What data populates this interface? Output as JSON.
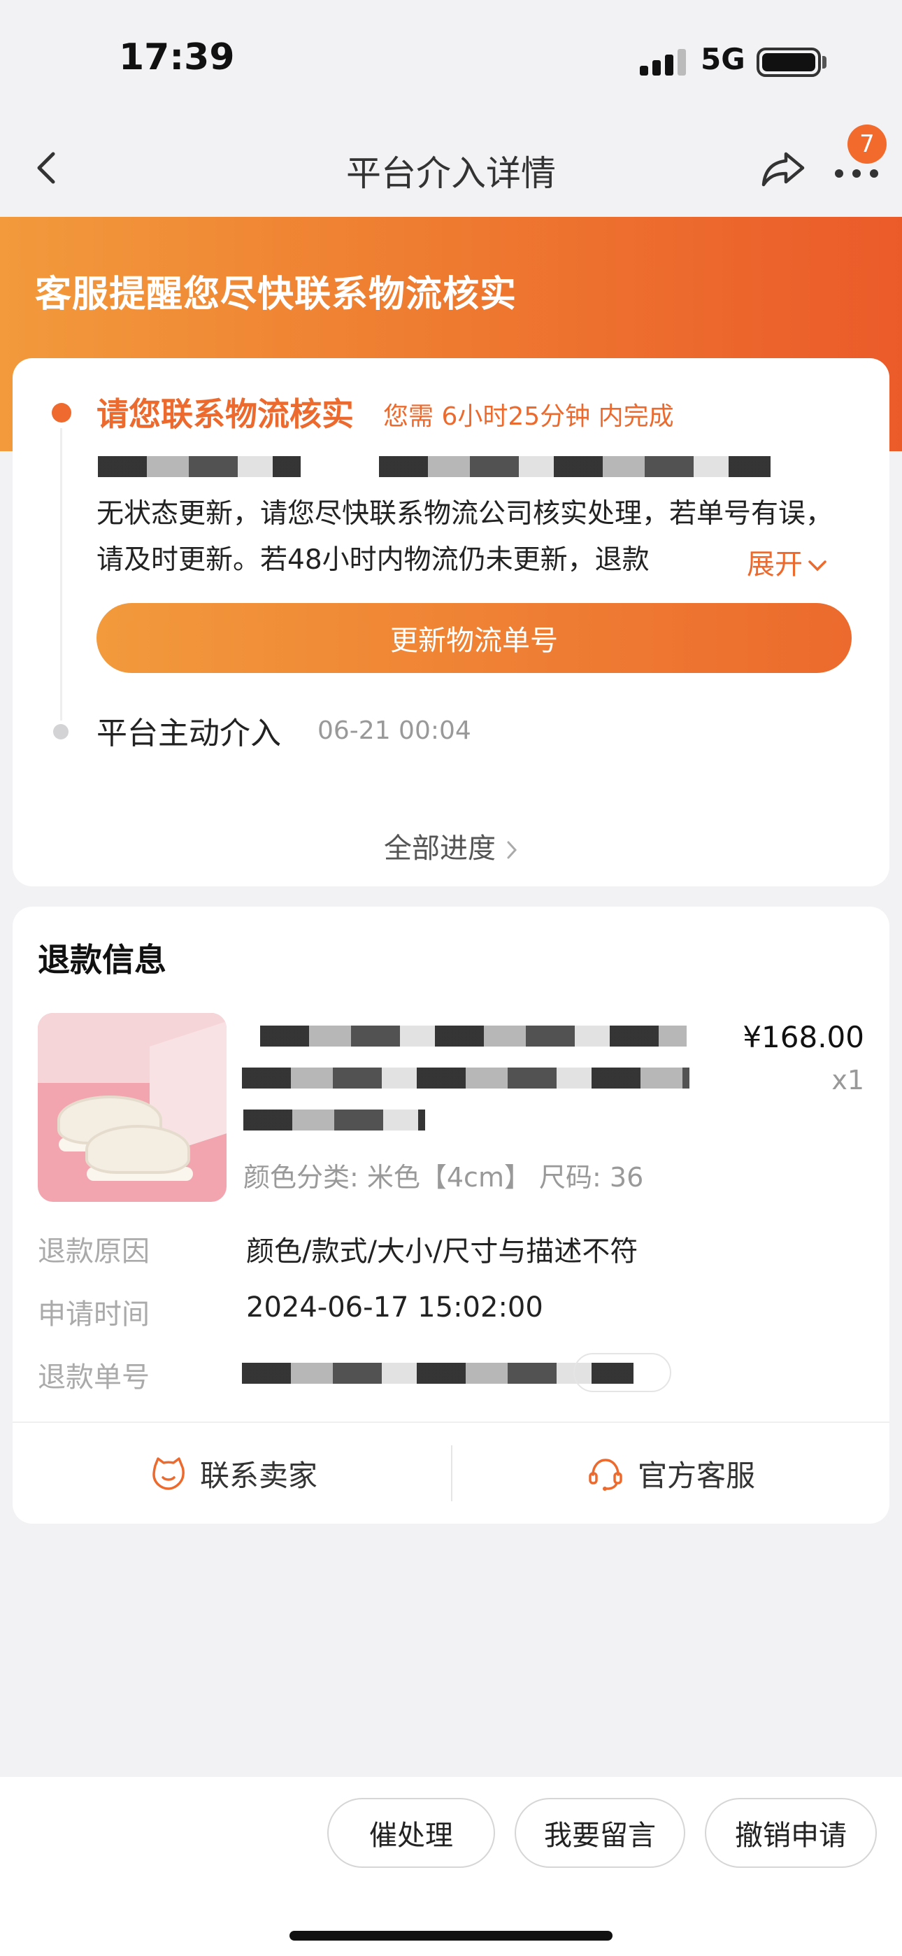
{
  "status_bar": {
    "time": "17:39",
    "network": "5G"
  },
  "nav": {
    "title": "平台介入详情",
    "badge_count": "7"
  },
  "banner": {
    "text": "客服提醒您尽快联系物流核实"
  },
  "progress": {
    "step_title": "请您联系物流核实",
    "deadline": "您需 6小时25分钟 内完成",
    "description": "无状态更新，请您尽快联系物流公司核实处理，若单号有误，请及时更新。若48小时内物流仍未更新，退款",
    "expand_label": "展开",
    "update_button": "更新物流单号",
    "step2_title": "平台主动介入",
    "step2_time": "06-21 00:04",
    "all_progress": "全部进度"
  },
  "refund": {
    "title": "退款信息",
    "price": "¥168.00",
    "quantity": "x1",
    "spec": "颜色分类: 米色【4cm】 尺码: 36",
    "rows": [
      {
        "label": "退款原因",
        "value": "颜色/款式/大小/尺寸与描述不符"
      },
      {
        "label": "申请时间",
        "value": "2024-06-17 15:02:00"
      },
      {
        "label": "退款单号",
        "value": ""
      }
    ],
    "contact_seller": "联系卖家",
    "official_service": "官方客服"
  },
  "bottom": {
    "urge": "催处理",
    "message": "我要留言",
    "cancel": "撤销申请"
  },
  "colors": {
    "accent": "#ec6a2d",
    "accent_light": "#f29a3c"
  }
}
